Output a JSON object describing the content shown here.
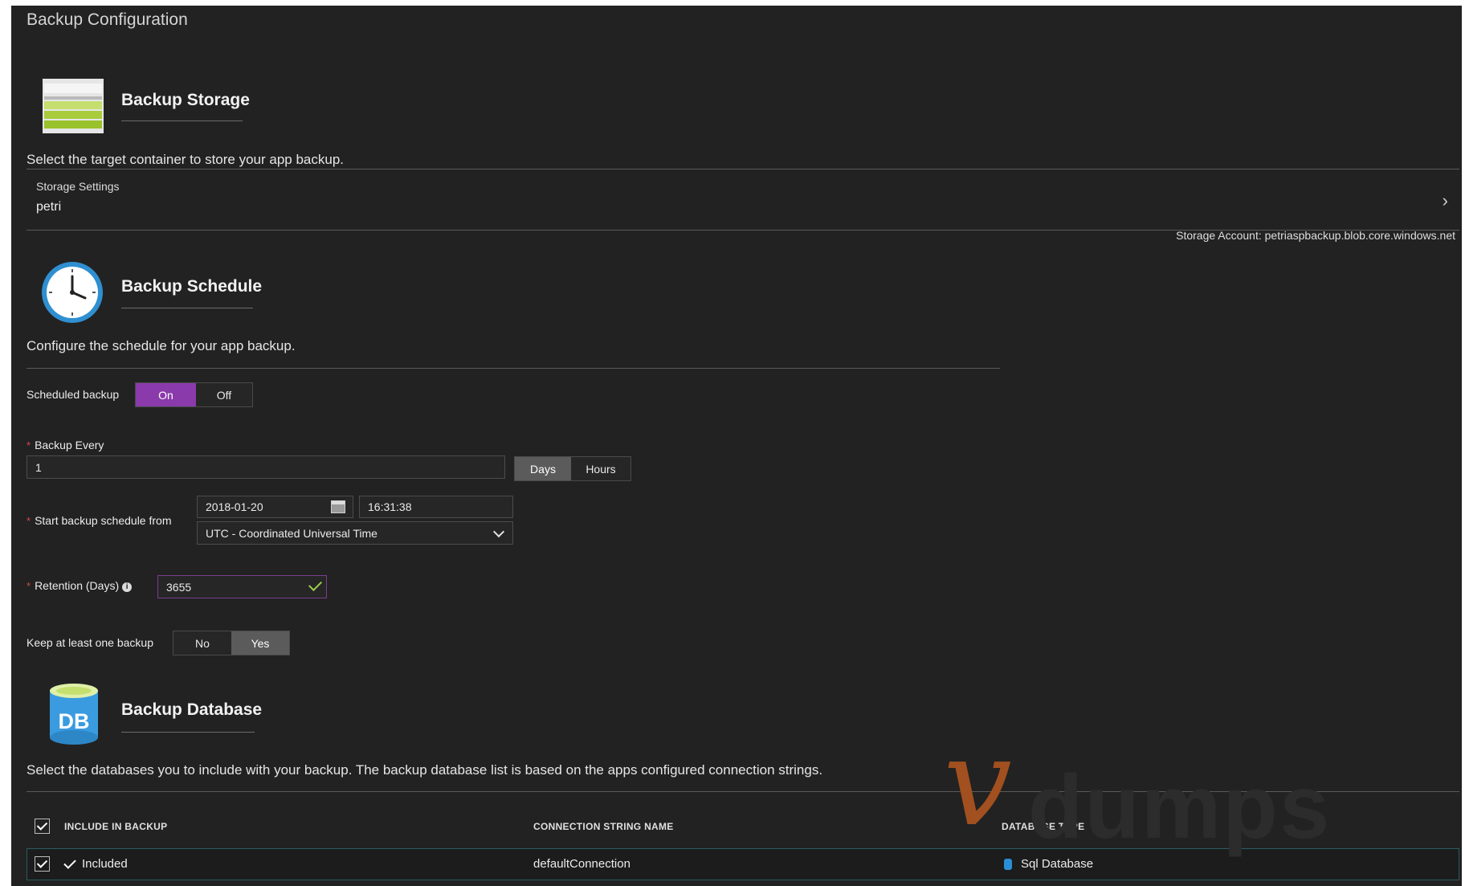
{
  "page": {
    "title": "Backup Configuration"
  },
  "storage": {
    "title": "Backup Storage",
    "description": "Select the target container to store your app backup.",
    "settings_label": "Storage Settings",
    "settings_value": "petri",
    "account": "Storage Account: petriaspbackup.blob.core.windows.net"
  },
  "schedule": {
    "title": "Backup Schedule",
    "description": "Configure the schedule for your app backup.",
    "scheduled_label": "Scheduled backup",
    "on_label": "On",
    "off_label": "Off",
    "scheduled_state": "On",
    "backup_every_label": "Backup Every",
    "backup_every_value": "1",
    "days_label": "Days",
    "hours_label": "Hours",
    "start_label": "Start backup schedule from",
    "start_date": "2018-01-20",
    "start_time": "16:31:38",
    "timezone": "UTC - Coordinated Universal Time",
    "retention_label": "Retention (Days)",
    "retention_value": "3655",
    "keep_label": "Keep at least one backup",
    "no_label": "No",
    "yes_label": "Yes",
    "keep_state": "Yes"
  },
  "database": {
    "title": "Backup Database",
    "description": "Select the databases you to include with your backup. The backup database list is based on the apps configured connection strings.",
    "icon_text": "DB",
    "columns": [
      "INCLUDE IN BACKUP",
      "CONNECTION STRING NAME",
      "DATABASE TYPE"
    ],
    "rows": [
      {
        "included": "Included",
        "connection": "defaultConnection",
        "type": "Sql Database"
      }
    ]
  },
  "watermark": {
    "letter": "v",
    "text": "dumps"
  },
  "colors": {
    "accent": "#8a3aab",
    "background": "#222222",
    "row_border": "#2b5b63"
  },
  "icons": [
    "storage-icon",
    "clock-icon",
    "database-icon",
    "chevron-right-icon",
    "calendar-icon",
    "info-icon",
    "checkmark-icon"
  ]
}
